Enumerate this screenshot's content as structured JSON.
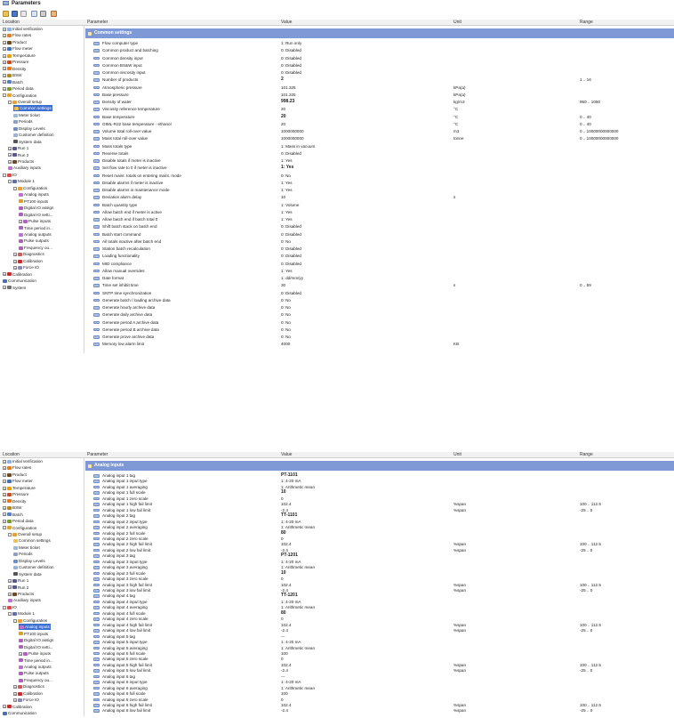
{
  "window": {
    "title": "Parameters"
  },
  "columns": {
    "location": "Location",
    "parameter": "Parameter",
    "value": "Value",
    "unit": "Unit",
    "range": "Range"
  },
  "tree1": [
    {
      "label": "Initial verification",
      "exp": "+",
      "lvl": 0,
      "icon": "search-icon"
    },
    {
      "label": "Flow rates",
      "exp": "+",
      "lvl": 0,
      "icon": "flow-icon"
    },
    {
      "label": "Product",
      "exp": "+",
      "lvl": 0,
      "icon": "drop-icon"
    },
    {
      "label": "Flow meter",
      "exp": "+",
      "lvl": 0,
      "icon": "meter-icon"
    },
    {
      "label": "Temperature",
      "exp": "+",
      "lvl": 0,
      "icon": "thermometer-icon"
    },
    {
      "label": "Pressure",
      "exp": "+",
      "lvl": 0,
      "icon": "gauge-icon"
    },
    {
      "label": "Density",
      "exp": "+",
      "lvl": 0,
      "icon": "density-icon"
    },
    {
      "label": "BSW",
      "exp": "+",
      "lvl": 0,
      "icon": "funnel-icon"
    },
    {
      "label": "Batch",
      "exp": "+",
      "lvl": 0,
      "icon": "batch-icon"
    },
    {
      "label": "Period data",
      "exp": "+",
      "lvl": 0,
      "icon": "period-icon"
    },
    {
      "label": "Configuration",
      "exp": "-",
      "lvl": 0,
      "icon": "config-icon"
    },
    {
      "label": "Overall setup",
      "exp": "-",
      "lvl": 1,
      "icon": "config-icon"
    },
    {
      "label": "Common settings",
      "exp": "",
      "lvl": 2,
      "icon": "settings-icon",
      "sel": true
    },
    {
      "label": "Meter ticket",
      "exp": "",
      "lvl": 2,
      "icon": "ticket-icon"
    },
    {
      "label": "Periods",
      "exp": "",
      "lvl": 2,
      "icon": "periods-icon"
    },
    {
      "label": "Display Levels",
      "exp": "",
      "lvl": 2,
      "icon": "display-icon"
    },
    {
      "label": "Customer definition",
      "exp": "",
      "lvl": 2,
      "icon": "customer-icon"
    },
    {
      "label": "System data",
      "exp": "",
      "lvl": 2,
      "icon": "system-data-icon"
    },
    {
      "label": "Run 1",
      "exp": "+",
      "lvl": 1,
      "icon": "run-icon"
    },
    {
      "label": "Run 2",
      "exp": "+",
      "lvl": 1,
      "icon": "run-icon"
    },
    {
      "label": "Products",
      "exp": "+",
      "lvl": 1,
      "icon": "drop-icon"
    },
    {
      "label": "Auxiliary inputs",
      "exp": "",
      "lvl": 1,
      "icon": "wave-icon"
    },
    {
      "label": "IO",
      "exp": "-",
      "lvl": 0,
      "icon": "io-icon"
    },
    {
      "label": "Module 1",
      "exp": "-",
      "lvl": 1,
      "icon": "module-icon"
    },
    {
      "label": "Configuration",
      "exp": "-",
      "lvl": 2,
      "icon": "config-icon"
    },
    {
      "label": "Analog inputs",
      "exp": "",
      "lvl": 3,
      "icon": "wave-icon"
    },
    {
      "label": "PT100 inputs",
      "exp": "",
      "lvl": 3,
      "icon": "thermometer-icon"
    },
    {
      "label": "Digital IO assign",
      "exp": "",
      "lvl": 3,
      "icon": "digital-icon"
    },
    {
      "label": "Digital IO setti...",
      "exp": "",
      "lvl": 3,
      "icon": "digital-icon"
    },
    {
      "label": "Pulse inputs",
      "exp": "+",
      "lvl": 3,
      "icon": "pulse-icon"
    },
    {
      "label": "Time period in...",
      "exp": "",
      "lvl": 3,
      "icon": "time-icon"
    },
    {
      "label": "Analog outputs",
      "exp": "",
      "lvl": 3,
      "icon": "wave-icon"
    },
    {
      "label": "Pulse outputs",
      "exp": "",
      "lvl": 3,
      "icon": "pulse-icon"
    },
    {
      "label": "Frequency ou...",
      "exp": "",
      "lvl": 3,
      "icon": "frequency-icon"
    },
    {
      "label": "Diagnostics",
      "exp": "+",
      "lvl": 2,
      "icon": "diagnostics-icon"
    },
    {
      "label": "Calibration",
      "exp": "+",
      "lvl": 2,
      "icon": "calibration-icon"
    },
    {
      "label": "Force IO",
      "exp": "+",
      "lvl": 2,
      "icon": "force-icon"
    },
    {
      "label": "Calibration",
      "exp": "+",
      "lvl": 0,
      "icon": "calibration-icon"
    },
    {
      "label": "Communication",
      "exp": "",
      "lvl": 0,
      "icon": "network-icon"
    },
    {
      "label": "System",
      "exp": "+",
      "lvl": 0,
      "icon": "gear-icon"
    }
  ],
  "section1": "Common settings",
  "rows1": [
    [
      "Flow computer type",
      "1: Run only",
      "",
      ""
    ],
    [
      "Common product and batching",
      "0: Disabled",
      "",
      ""
    ],
    [
      "Common density input",
      "0: Disabled",
      "",
      ""
    ],
    [
      "Common BS&W input",
      "0: Disabled",
      "",
      ""
    ],
    [
      "Common viscosity input",
      "0: Disabled",
      "",
      ""
    ],
    [
      "Number of products",
      "2",
      "",
      "1 .. 16",
      "b"
    ],
    [
      "Atmospheric pressure",
      "101.325",
      "kPa(a)",
      ""
    ],
    [
      "Base pressure",
      "101.325",
      "kPa(a)",
      ""
    ],
    [
      "Density of water",
      "998.23",
      "kg/m3",
      "950 .. 1050",
      "b"
    ],
    [
      "Viscosity reference temperature",
      "20",
      "°C",
      ""
    ],
    [
      "Base temperature",
      "20",
      "°C",
      "0 .. 40",
      "b"
    ],
    [
      "OIML-R22 base temperature - ethanol",
      "20",
      "°C",
      "0 .. 40"
    ],
    [
      "Volume total roll-over value",
      "1000000000",
      "m3",
      "0 .. 10000000000000"
    ],
    [
      "Mass total roll-over value",
      "1000000000",
      "tonne",
      "0 .. 10000000000000"
    ],
    [
      "Mass totals type",
      "1: Mass in vacuum",
      "",
      ""
    ],
    [
      "Reverse totals",
      "0: Disabled",
      "",
      ""
    ],
    [
      "Disable totals if meter is inactive",
      "1: Yes",
      "",
      ""
    ],
    [
      "Set flow rate to 0 if meter is inactive",
      "1: Yes",
      "",
      "",
      "b"
    ],
    [
      "Reset maint. totals on entering maint. mode",
      "0: No",
      "",
      ""
    ],
    [
      "Disable alarms if meter is inactive",
      "1: Yes",
      "",
      ""
    ],
    [
      "Disable alarms in maintenance mode",
      "1: Yes",
      "",
      ""
    ],
    [
      "Deviation alarm delay",
      "10",
      "s",
      ""
    ],
    [
      "Batch quantity type",
      "1: Volume",
      "",
      ""
    ],
    [
      "Allow batch end if meter is active",
      "1: Yes",
      "",
      ""
    ],
    [
      "Allow batch end if batch total 0",
      "1: Yes",
      "",
      ""
    ],
    [
      "Shift batch stack on batch end",
      "0: Disabled",
      "",
      ""
    ],
    [
      "Batch start command",
      "0: Disabled",
      "",
      ""
    ],
    [
      "All totals inactive after batch end",
      "0: No",
      "",
      ""
    ],
    [
      "Station batch recalculation",
      "0: Disabled",
      "",
      ""
    ],
    [
      "Loading functionality",
      "0: Disabled",
      "",
      ""
    ],
    [
      "MID compliance",
      "0: Disabled",
      "",
      ""
    ],
    [
      "Allow manual overrides",
      "1: Yes",
      "",
      ""
    ],
    [
      "Date format",
      "1: dd/mm/yy",
      "",
      ""
    ],
    [
      "Time set inhibit time",
      "30",
      "s",
      "0 .. 59"
    ],
    [
      "SNTP time synchronization",
      "0: Disabled",
      "",
      ""
    ],
    [
      "Generate batch / loading archive data",
      "0: No",
      "",
      ""
    ],
    [
      "Generate hourly archive data",
      "0: No",
      "",
      ""
    ],
    [
      "Generate daily archive data",
      "0: No",
      "",
      ""
    ],
    [
      "Generate period A archive data",
      "0: No",
      "",
      ""
    ],
    [
      "Generate period B archive data",
      "0: No",
      "",
      ""
    ],
    [
      "Generate prove archive data",
      "0: No",
      "",
      ""
    ],
    [
      "Memory low alarm limit",
      "4000",
      "KB",
      ""
    ]
  ],
  "tree2": [
    {
      "label": "Initial verification",
      "exp": "+",
      "lvl": 0,
      "icon": "search-icon"
    },
    {
      "label": "Flow rates",
      "exp": "+",
      "lvl": 0,
      "icon": "flow-icon"
    },
    {
      "label": "Product",
      "exp": "+",
      "lvl": 0,
      "icon": "drop-icon"
    },
    {
      "label": "Flow meter",
      "exp": "+",
      "lvl": 0,
      "icon": "meter-icon"
    },
    {
      "label": "Temperature",
      "exp": "+",
      "lvl": 0,
      "icon": "thermometer-icon"
    },
    {
      "label": "Pressure",
      "exp": "+",
      "lvl": 0,
      "icon": "gauge-icon"
    },
    {
      "label": "Density",
      "exp": "+",
      "lvl": 0,
      "icon": "density-icon"
    },
    {
      "label": "BSW",
      "exp": "+",
      "lvl": 0,
      "icon": "funnel-icon"
    },
    {
      "label": "Batch",
      "exp": "+",
      "lvl": 0,
      "icon": "batch-icon"
    },
    {
      "label": "Period data",
      "exp": "+",
      "lvl": 0,
      "icon": "period-icon"
    },
    {
      "label": "Configuration",
      "exp": "-",
      "lvl": 0,
      "icon": "config-icon"
    },
    {
      "label": "Overall setup",
      "exp": "-",
      "lvl": 1,
      "icon": "config-icon"
    },
    {
      "label": "Common settings",
      "exp": "",
      "lvl": 2,
      "icon": "settings-icon"
    },
    {
      "label": "Meter ticket",
      "exp": "",
      "lvl": 2,
      "icon": "ticket-icon"
    },
    {
      "label": "Periods",
      "exp": "",
      "lvl": 2,
      "icon": "periods-icon"
    },
    {
      "label": "Display Levels",
      "exp": "",
      "lvl": 2,
      "icon": "display-icon"
    },
    {
      "label": "Customer definition",
      "exp": "",
      "lvl": 2,
      "icon": "customer-icon"
    },
    {
      "label": "System data",
      "exp": "",
      "lvl": 2,
      "icon": "system-data-icon"
    },
    {
      "label": "Run 1",
      "exp": "+",
      "lvl": 1,
      "icon": "run-icon"
    },
    {
      "label": "Run 2",
      "exp": "+",
      "lvl": 1,
      "icon": "run-icon"
    },
    {
      "label": "Products",
      "exp": "+",
      "lvl": 1,
      "icon": "drop-icon"
    },
    {
      "label": "Auxiliary inputs",
      "exp": "",
      "lvl": 1,
      "icon": "wave-icon"
    },
    {
      "label": "IO",
      "exp": "-",
      "lvl": 0,
      "icon": "io-icon"
    },
    {
      "label": "Module 1",
      "exp": "-",
      "lvl": 1,
      "icon": "module-icon"
    },
    {
      "label": "Configuration",
      "exp": "-",
      "lvl": 2,
      "icon": "config-icon"
    },
    {
      "label": "Analog inputs",
      "exp": "",
      "lvl": 3,
      "icon": "wave-icon",
      "sel": true
    },
    {
      "label": "PT100 inputs",
      "exp": "",
      "lvl": 3,
      "icon": "thermometer-icon"
    },
    {
      "label": "Digital IO assign",
      "exp": "",
      "lvl": 3,
      "icon": "digital-icon"
    },
    {
      "label": "Digital IO setti...",
      "exp": "",
      "lvl": 3,
      "icon": "digital-icon"
    },
    {
      "label": "Pulse inputs",
      "exp": "+",
      "lvl": 3,
      "icon": "pulse-icon"
    },
    {
      "label": "Time period in...",
      "exp": "",
      "lvl": 3,
      "icon": "time-icon"
    },
    {
      "label": "Analog outputs",
      "exp": "",
      "lvl": 3,
      "icon": "wave-icon"
    },
    {
      "label": "Pulse outputs",
      "exp": "",
      "lvl": 3,
      "icon": "pulse-icon"
    },
    {
      "label": "Frequency ou...",
      "exp": "",
      "lvl": 3,
      "icon": "frequency-icon"
    },
    {
      "label": "Diagnostics",
      "exp": "+",
      "lvl": 2,
      "icon": "diagnostics-icon"
    },
    {
      "label": "Calibration",
      "exp": "+",
      "lvl": 2,
      "icon": "calibration-icon"
    },
    {
      "label": "Force IO",
      "exp": "+",
      "lvl": 2,
      "icon": "force-icon"
    },
    {
      "label": "Calibration",
      "exp": "+",
      "lvl": 0,
      "icon": "calibration-icon"
    },
    {
      "label": "Communication",
      "exp": "",
      "lvl": 0,
      "icon": "network-icon"
    },
    {
      "label": "System",
      "exp": "+",
      "lvl": 0,
      "icon": "gear-icon"
    }
  ],
  "section2": "Analog inputs",
  "rows2": [
    [
      "Analog input 1 tag",
      "PT-1101",
      "",
      "",
      "b"
    ],
    [
      "Analog input 1 input type",
      "1: 4-20 mA",
      "",
      ""
    ],
    [
      "Analog input 1 averaging",
      "1: Arithmetic mean",
      "",
      ""
    ],
    [
      "Analog input 1 full scale",
      "10",
      "",
      "",
      "b"
    ],
    [
      "Analog input 1 zero scale",
      "0",
      "",
      ""
    ],
    [
      "Analog input 1 high fail limit",
      "102.4",
      "%span",
      "100 .. 112.5"
    ],
    [
      "Analog input 1 low fail limit",
      "-2.4",
      "%span",
      "-25 .. 0"
    ],
    [
      "Analog input 2 tag",
      "TT-1101",
      "",
      "",
      "b"
    ],
    [
      "Analog input 2 input type",
      "1: 4-20 mA",
      "",
      ""
    ],
    [
      "Analog input 2 averaging",
      "1: Arithmetic mean",
      "",
      ""
    ],
    [
      "Analog input 2 full scale",
      "80",
      "",
      "",
      "b"
    ],
    [
      "Analog input 2 zero scale",
      "0",
      "",
      ""
    ],
    [
      "Analog input 2 high fail limit",
      "102.4",
      "%span",
      "100 .. 112.5"
    ],
    [
      "Analog input 2 low fail limit",
      "-2.4",
      "%span",
      "-25 .. 0"
    ],
    [
      "Analog input 3 tag",
      "PT-1201",
      "",
      "",
      "b"
    ],
    [
      "Analog input 3 input type",
      "1: 4-20 mA",
      "",
      ""
    ],
    [
      "Analog input 3 averaging",
      "1: Arithmetic mean",
      "",
      ""
    ],
    [
      "Analog input 3 full scale",
      "10",
      "",
      "",
      "b"
    ],
    [
      "Analog input 3 zero scale",
      "0",
      "",
      ""
    ],
    [
      "Analog input 3 high fail limit",
      "102.4",
      "%span",
      "100 .. 112.5"
    ],
    [
      "Analog input 3 low fail limit",
      "-2.4",
      "%span",
      "-25 .. 0"
    ],
    [
      "Analog input 4 tag",
      "TT-1201",
      "",
      "",
      "b"
    ],
    [
      "Analog input 4 input type",
      "1: 4-20 mA",
      "",
      ""
    ],
    [
      "Analog input 4 averaging",
      "1: Arithmetic mean",
      "",
      ""
    ],
    [
      "Analog input 4 full scale",
      "80",
      "",
      "",
      "b"
    ],
    [
      "Analog input 4 zero scale",
      "0",
      "",
      ""
    ],
    [
      "Analog input 4 high fail limit",
      "102.4",
      "%span",
      "100 .. 112.5"
    ],
    [
      "Analog input 4 low fail limit",
      "-2.4",
      "%span",
      "-25 .. 0"
    ],
    [
      "Analog input 5 tag",
      "---",
      "",
      ""
    ],
    [
      "Analog input 5 input type",
      "1: 4-20 mA",
      "",
      ""
    ],
    [
      "Analog input 5 averaging",
      "1: Arithmetic mean",
      "",
      ""
    ],
    [
      "Analog input 5 full scale",
      "100",
      "",
      ""
    ],
    [
      "Analog input 5 zero scale",
      "0",
      "",
      ""
    ],
    [
      "Analog input 5 high fail limit",
      "102.4",
      "%span",
      "100 .. 112.5"
    ],
    [
      "Analog input 5 low fail limit",
      "-2.4",
      "%span",
      "-25 .. 0"
    ],
    [
      "Analog input 6 tag",
      "---",
      "",
      ""
    ],
    [
      "Analog input 6 input type",
      "1: 4-20 mA",
      "",
      ""
    ],
    [
      "Analog input 6 averaging",
      "1: Arithmetic mean",
      "",
      ""
    ],
    [
      "Analog input 6 full scale",
      "100",
      "",
      ""
    ],
    [
      "Analog input 6 zero scale",
      "0",
      "",
      ""
    ],
    [
      "Analog input 6 high fail limit",
      "102.4",
      "%span",
      "100 .. 112.5"
    ],
    [
      "Analog input 6 low fail limit",
      "-2.4",
      "%span",
      "-25 .. 0"
    ]
  ],
  "colors": {
    "section": "#7f99d6",
    "selection": "#3d6fd1"
  }
}
